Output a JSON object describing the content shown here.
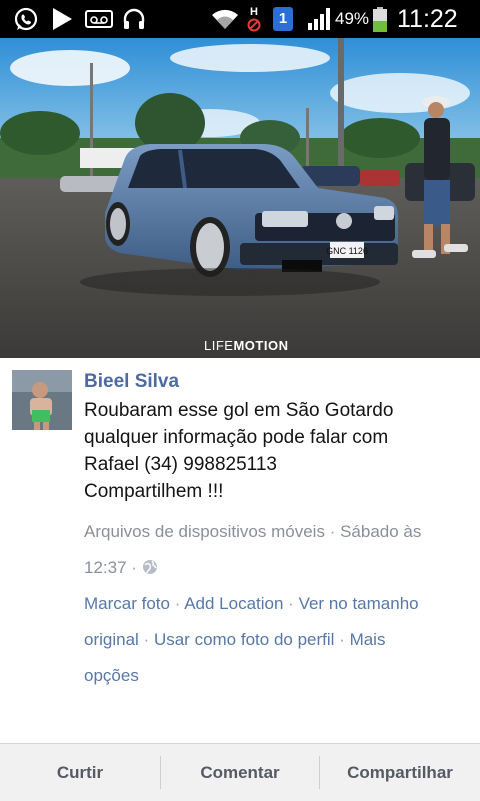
{
  "status_bar": {
    "icons": [
      "whatsapp-icon",
      "play-store-icon",
      "voicemail-icon",
      "headset-icon",
      "wifi-icon",
      "no-hspa-icon",
      "notification-badge-icon",
      "signal-icon",
      "battery-icon"
    ],
    "network_letter": "H",
    "badge": "1",
    "battery": "49%",
    "battery_level": 0.49,
    "time": "11:22"
  },
  "photo": {
    "plate": "GNC 1126",
    "watermark_a": "LIFE",
    "watermark_b": "MOTION"
  },
  "post": {
    "author": "Bieel Silva",
    "message_lines": [
      "Roubaram esse gol em São Gotardo",
      "qualquer informação pode falar com",
      "Rafael (34) 998825113",
      "Compartilhem !!!"
    ],
    "meta": {
      "album": "Arquivos de dispositivos móveis",
      "sep": "·",
      "date_part1": "Sábado às",
      "date_part2": "12:37",
      "privacy_icon": "globe-icon"
    },
    "actions": {
      "tag_photo": "Marcar foto",
      "add_location": "Add Location",
      "view_full_1": "Ver no tamanho",
      "view_full_2": "original",
      "profile_photo": "Usar como foto do perfil",
      "more_1": "Mais",
      "more_2": "opções"
    }
  },
  "bottom_bar": {
    "like": "Curtir",
    "comment": "Comentar",
    "share": "Compartilhar"
  }
}
